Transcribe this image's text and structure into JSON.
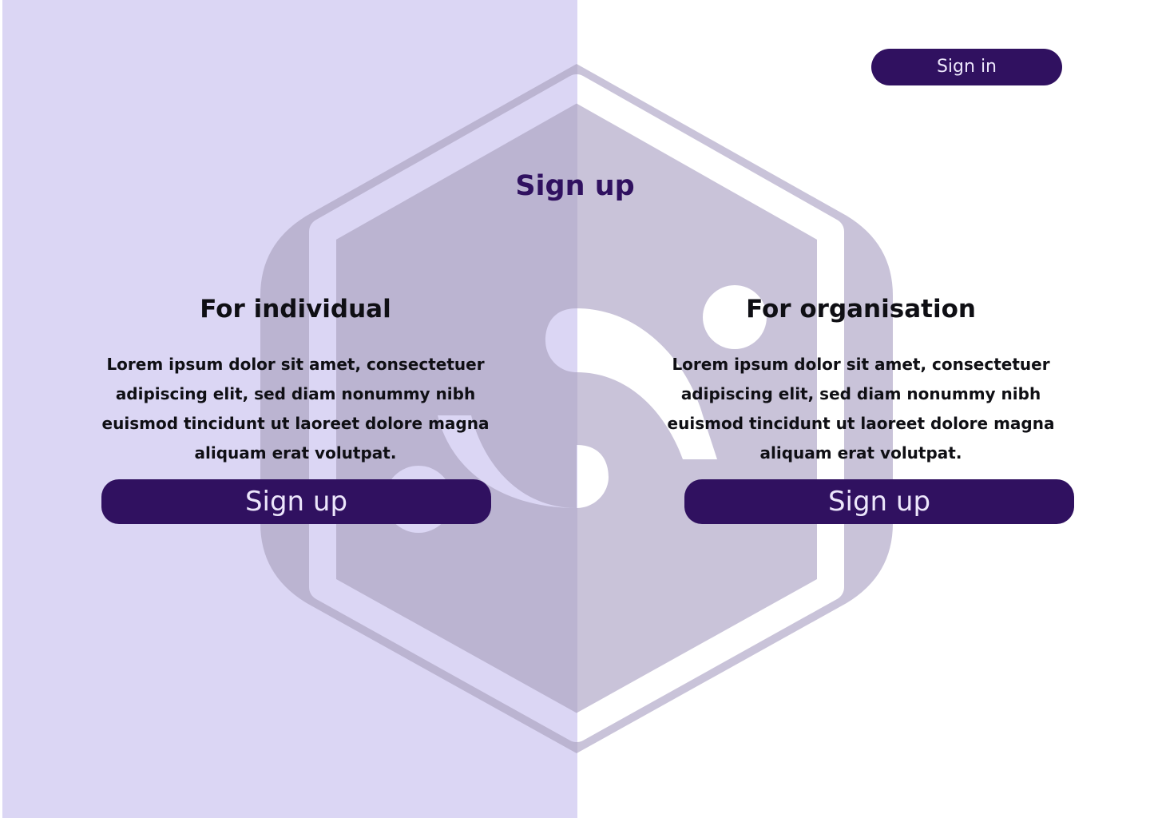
{
  "header": {
    "signin_label": "Sign in"
  },
  "page": {
    "title": "Sign up"
  },
  "individual": {
    "heading": "For individual",
    "description": "Lorem ipsum dolor sit amet, consectetuer adipiscing elit, sed diam nonummy nibh euismod tincidunt ut laoreet dolore magna aliquam erat volutpat.",
    "button_label": "Sign up"
  },
  "organisation": {
    "heading": "For organisation",
    "description": "Lorem ipsum dolor sit amet, consectetuer adipiscing elit, sed diam nonummy nibh euismod tincidunt ut laoreet dolore magna aliquam erat volutpat.",
    "button_label": "Sign up"
  },
  "colors": {
    "brand": "#301160",
    "left_panel": "#ebe8fd",
    "logo_watermark": "#c9c3d9",
    "button_text": "#ece6fb"
  },
  "icons": {
    "background_logo": "hexagon-s-logo"
  }
}
